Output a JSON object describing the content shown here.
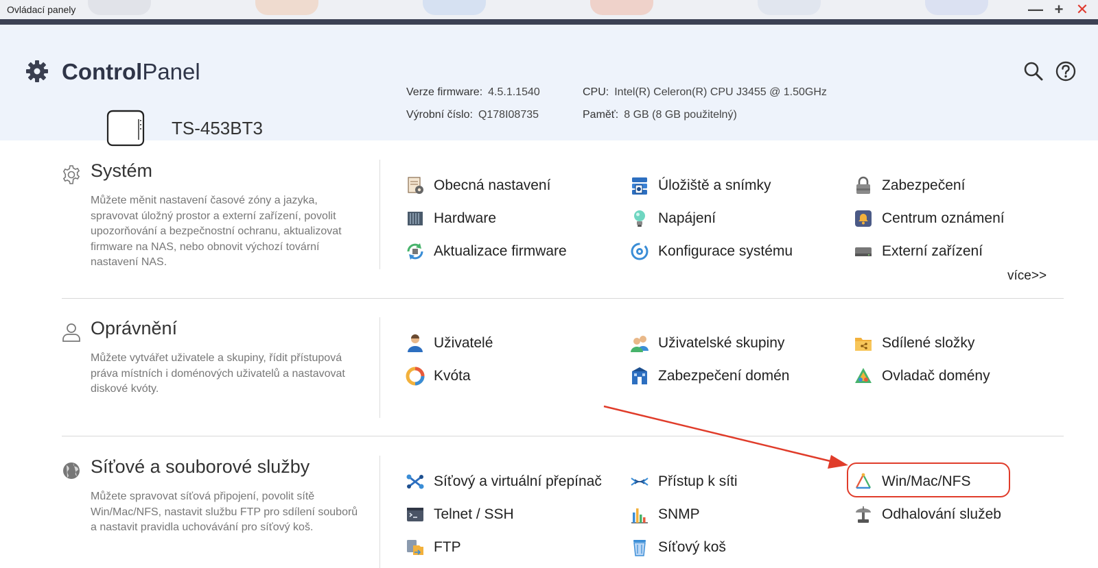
{
  "window": {
    "title": "Ovládací panely",
    "controls": {
      "minimize": "—",
      "maximize": "+",
      "close": "✕"
    }
  },
  "header": {
    "brand_bold": "Control",
    "brand_light": "Panel",
    "icons": {
      "search": "search-icon",
      "help": "help-icon"
    },
    "device": {
      "model": "TS-453BT3",
      "firmware_label": "Verze firmware:",
      "firmware_value": "4.5.1.1540",
      "serial_label": "Výrobní číslo:",
      "serial_value": "Q178I08735",
      "cpu_label": "CPU:",
      "cpu_value": "Intel(R) Celeron(R) CPU J3455 @ 1.50GHz",
      "memory_label": "Paměť:",
      "memory_value": "8 GB (8 GB použitelný)"
    }
  },
  "sections": {
    "system": {
      "title": "Systém",
      "description": "Můžete měnit nastavení časové zóny a jazyka, spravovat úložný prostor a externí zařízení, povolit upozorňování a bezpečnostní ochranu, aktualizovat firmware na NAS, nebo obnovit výchozí tovární nastavení NAS.",
      "items": [
        {
          "label": "Obecná nastavení",
          "icon": "general-settings-icon"
        },
        {
          "label": "Úložiště a snímky",
          "icon": "storage-snapshots-icon"
        },
        {
          "label": "Zabezpečení",
          "icon": "lock-icon"
        },
        {
          "label": "Hardware",
          "icon": "hardware-icon"
        },
        {
          "label": "Napájení",
          "icon": "power-bulb-icon"
        },
        {
          "label": "Centrum oznámení",
          "icon": "notification-center-icon"
        },
        {
          "label": "Aktualizace firmware",
          "icon": "firmware-update-icon"
        },
        {
          "label": "Konfigurace systému",
          "icon": "system-config-icon"
        },
        {
          "label": "Externí zařízení",
          "icon": "external-device-icon"
        }
      ],
      "more": "více>>"
    },
    "permissions": {
      "title": "Oprávnění",
      "description": "Můžete vytvářet uživatele a skupiny, řídit přístupová práva místních i doménových uživatelů a nastavovat diskové kvóty.",
      "items": [
        {
          "label": "Uživatelé",
          "icon": "user-icon"
        },
        {
          "label": "Uživatelské skupiny",
          "icon": "user-groups-icon"
        },
        {
          "label": "Sdílené složky",
          "icon": "shared-folder-icon"
        },
        {
          "label": "Kvóta",
          "icon": "quota-icon"
        },
        {
          "label": "Zabezpečení domén",
          "icon": "domain-security-icon"
        },
        {
          "label": "Ovladač domény",
          "icon": "domain-controller-icon"
        }
      ]
    },
    "network": {
      "title": "Síťové a souborové služby",
      "description": "Můžete spravovat síťová připojení, povolit sítě Win/Mac/NFS, nastavit službu FTP pro sdílení souborů a nastavit pravidla uchovávání pro síťový koš.",
      "items": [
        {
          "label": "Síťový a virtuální přepínač",
          "icon": "network-switch-icon"
        },
        {
          "label": "Přístup k síti",
          "icon": "network-access-icon"
        },
        {
          "label": "Win/Mac/NFS",
          "icon": "win-mac-nfs-icon"
        },
        {
          "label": "Telnet / SSH",
          "icon": "terminal-icon"
        },
        {
          "label": "SNMP",
          "icon": "snmp-chart-icon"
        },
        {
          "label": "Odhalování služeb",
          "icon": "service-discovery-icon"
        },
        {
          "label": "FTP",
          "icon": "ftp-icon"
        },
        {
          "label": "Síťový koš",
          "icon": "recycle-bin-icon"
        }
      ]
    }
  },
  "colors": {
    "header_bg": "#eef3fb",
    "annotation": "#e03c2a",
    "brand_text": "#2f3548"
  }
}
